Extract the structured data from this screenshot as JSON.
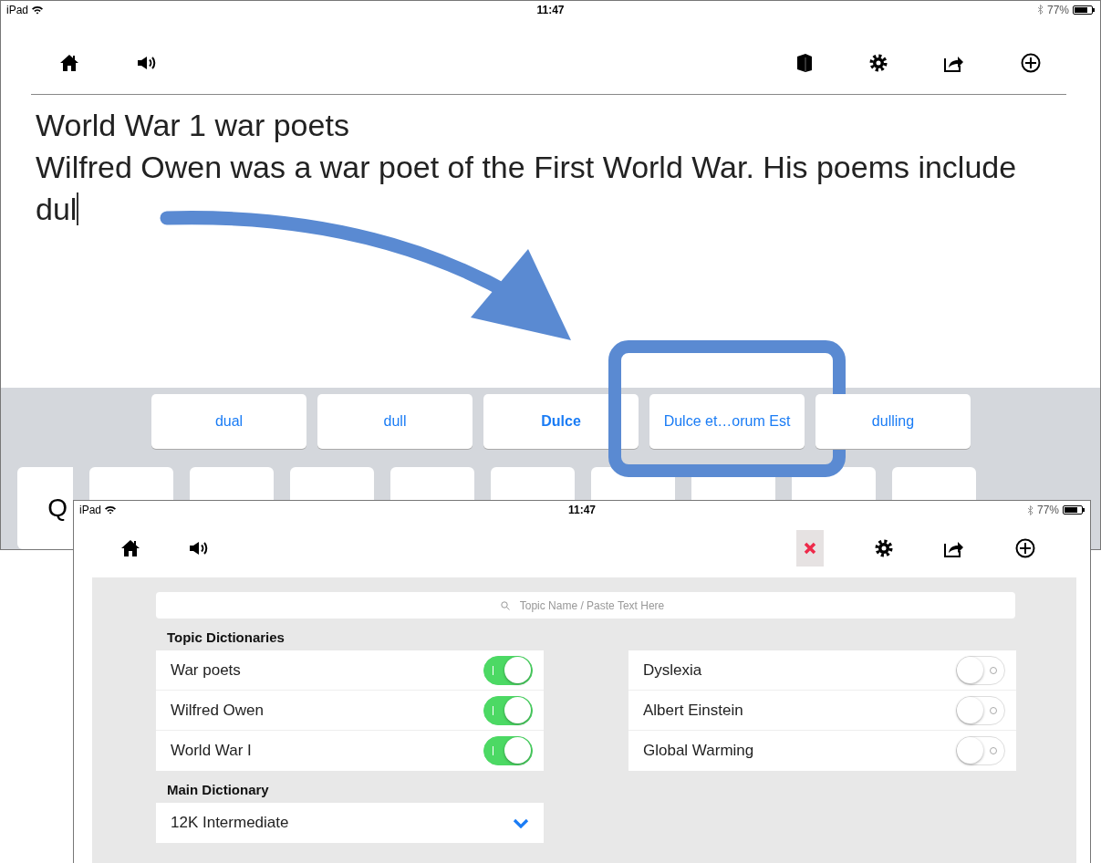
{
  "editor_screen": {
    "status_bar": {
      "device": "iPad",
      "time": "11:47",
      "battery": "77%"
    },
    "document_lines": [
      "World War 1 war poets",
      "Wilfred Owen was a war poet of the First World War. His poems include",
      "dul"
    ],
    "suggestions": [
      {
        "label": "dual",
        "default": false,
        "highlighted": false
      },
      {
        "label": "dull",
        "default": false,
        "highlighted": false
      },
      {
        "label": "Dulce",
        "default": true,
        "highlighted": false
      },
      {
        "label": "Dulce et…orum Est",
        "default": false,
        "highlighted": true
      },
      {
        "label": "dulling",
        "default": false,
        "highlighted": false
      }
    ],
    "keyboard_keys": [
      "Q"
    ]
  },
  "dictionary_screen": {
    "status_bar": {
      "device": "iPad",
      "time": "11:47",
      "battery": "77%"
    },
    "search": {
      "placeholder": "Topic Name / Paste Text Here"
    },
    "topic_dictionaries": {
      "title": "Topic Dictionaries",
      "left": [
        {
          "name": "War poets",
          "on": true
        },
        {
          "name": "Wilfred Owen",
          "on": true
        },
        {
          "name": "World War I",
          "on": true
        }
      ],
      "right": [
        {
          "name": "Dyslexia",
          "on": false
        },
        {
          "name": "Albert Einstein",
          "on": false
        },
        {
          "name": "Global Warming",
          "on": false
        }
      ]
    },
    "main_dictionary": {
      "title": "Main Dictionary",
      "value": "12K Intermediate"
    }
  }
}
